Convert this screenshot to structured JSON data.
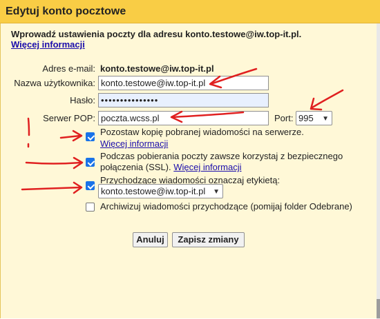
{
  "dialog": {
    "title": "Edytuj konto pocztowe",
    "intro": "Wprowadź ustawienia poczty dla adresu konto.testowe@iw.top-it.pl.",
    "more_info": "Więcej informacji"
  },
  "form": {
    "email_label": "Adres e-mail:",
    "email_value": "konto.testowe@iw.top-it.pl",
    "username_label": "Nazwa użytkownika:",
    "username_value": "konto.testowe@iw.top-it.pl",
    "password_label": "Hasło:",
    "password_value": "•••••••••••••••",
    "pop_label": "Serwer POP:",
    "pop_value": "poczta.wcss.pl",
    "port_label": "Port:",
    "port_value": "995"
  },
  "options": {
    "leave_copy": {
      "checked": true,
      "label": "Pozostaw kopię pobranej wiadomości na serwerze.",
      "link": "Więcej informacji"
    },
    "ssl": {
      "checked": true,
      "label_line1": "Podczas pobierania poczty zawsze korzystaj z bezpiecznego",
      "label_line2": "połączenia (SSL).",
      "link": "Więcej informacji"
    },
    "label_incoming": {
      "checked": true,
      "label": "Przychodzące wiadomości oznaczaj etykietą:",
      "select_value": "konto.testowe@iw.top-it.pl"
    },
    "archive": {
      "checked": false,
      "label": "Archiwizuj wiadomości przychodzące (pomijaj folder Odebrane)"
    }
  },
  "buttons": {
    "cancel": "Anuluj",
    "save": "Zapisz zmiany"
  },
  "colors": {
    "title_bar": "#f9cd45",
    "panel_background": "#fff8d7",
    "checkbox_checked": "#1a73e8",
    "annotation_red": "#e02020",
    "link": "#1a0dab"
  },
  "icons": {
    "dropdown": "chevron-down-icon",
    "annotation": "red-arrow-annotation"
  }
}
